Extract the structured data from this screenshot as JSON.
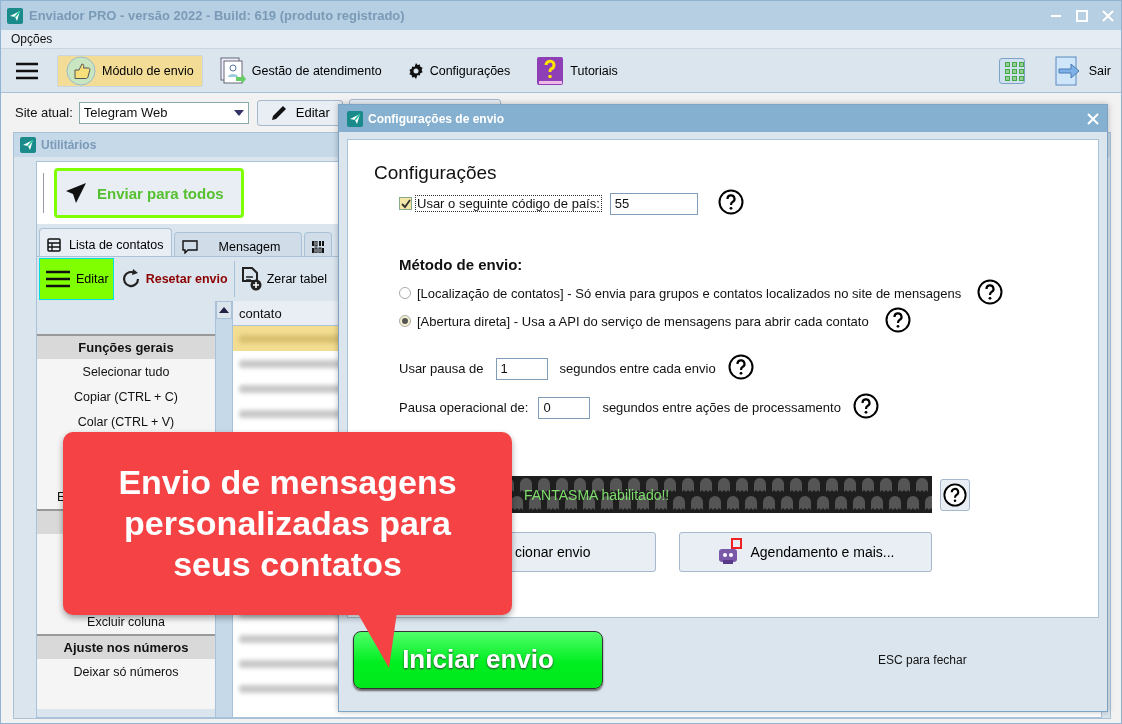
{
  "window": {
    "title": "Enviador PRO - versão 2022 - Build: 619 (produto registrado)"
  },
  "menu": [
    "Opções"
  ],
  "toolbar": [
    {
      "label": "Módulo de envio",
      "kind": "thumb",
      "selected": true
    },
    {
      "label": "Gestão de atendimento",
      "kind": "contacts",
      "selected": false
    },
    {
      "label": "Configurações",
      "kind": "gear",
      "selected": false
    },
    {
      "label": "Tutoriais",
      "kind": "book",
      "selected": false
    }
  ],
  "exit_button": {
    "label": "Sair"
  },
  "site": {
    "label": "Site atual:",
    "value": "Telegram Web",
    "edit_button": "Editar"
  },
  "utilities": {
    "title": "Utilitários",
    "send_all_button": "Enviar para todos",
    "tabs": [
      {
        "label": "Lista de contatos",
        "kind": "list",
        "selected": true
      },
      {
        "label": "Mensagem",
        "kind": "chat",
        "selected": false
      },
      {
        "kind": "binary",
        "selected": false
      }
    ],
    "actions": [
      {
        "label": "Editar",
        "kind": "menu"
      },
      {
        "label": "Resetar envio",
        "kind": "reset"
      },
      {
        "label": "Zerar tabel",
        "kind": "file"
      }
    ],
    "functions": [
      {
        "label": "Funções gerais",
        "kind": "header"
      },
      {
        "label": "Selecionar tudo",
        "kind": "item"
      },
      {
        "label": "Copiar (CTRL + C)",
        "kind": "item"
      },
      {
        "label": "Colar (CTRL + V)",
        "kind": "item"
      },
      {
        "kind": "item"
      },
      {
        "kind": "item"
      },
      {
        "label": "E",
        "kind": "cut"
      },
      {
        "kind": "header"
      },
      {
        "kind": "item"
      },
      {
        "kind": "item"
      },
      {
        "kind": "item"
      },
      {
        "label": "Excluir coluna",
        "kind": "item"
      },
      {
        "label": "Ajuste nos números",
        "kind": "header"
      },
      {
        "label": "Deixar só números",
        "kind": "item"
      },
      {
        "kind": "item"
      }
    ],
    "table": {
      "columns": [
        "contato"
      ],
      "rows": [
        {
          "selected": true
        },
        {
          "selected": false
        },
        {
          "selected": false
        },
        {
          "selected": false
        },
        {
          "selected": false
        },
        {
          "selected": false
        },
        {
          "selected": false
        },
        {
          "selected": false
        }
      ]
    }
  },
  "dialog": {
    "title": "Configurações de envio",
    "heading": "Configurações",
    "country_code": {
      "label": "Usar o seguinte código de país:",
      "checked": true,
      "value": "55"
    },
    "method": {
      "heading": "Método de envio:",
      "options": [
        {
          "label": "[Localização de contatos] - Só envia para grupos e contatos localizados no site de mensagens",
          "selected": false
        },
        {
          "label": "[Abertura direta] - Usa a API do serviço de mensagens para abrir cada contato",
          "selected": true
        }
      ]
    },
    "pause": {
      "label": "Usar pausa de",
      "value": "1",
      "suffix": "segundos entre cada envio"
    },
    "operational_pause": {
      "label": "Pausa operacional de:",
      "value": "0",
      "suffix": "segundos entre ações de processamento"
    },
    "ghost_banner": "FANTASMA habilitado!!",
    "buttons": [
      {
        "label": "cionar envio",
        "kind": "plain"
      },
      {
        "label": "Agendamento e mais...",
        "kind": "robot"
      }
    ],
    "start_button": "Iniciar envio",
    "hint": "ESC para fechar"
  },
  "callout": {
    "text": "Envio de mensagens personalizadas para seus contatos"
  }
}
